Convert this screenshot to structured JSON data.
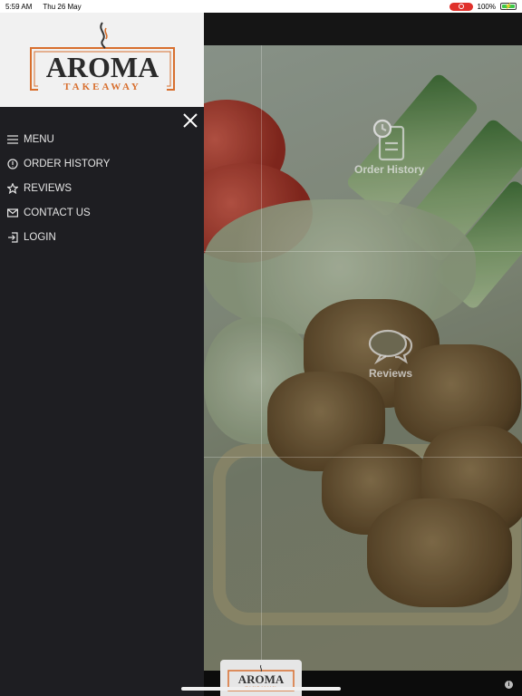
{
  "status_bar": {
    "time": "5:59 AM",
    "date": "Thu 26 May",
    "battery": "100%"
  },
  "brand": {
    "name_main": "AROMA",
    "name_sub": "TAKEAWAY",
    "accent_color": "#d86f2e"
  },
  "menu": {
    "items": [
      {
        "label": "MENU",
        "icon": "hamburger-icon"
      },
      {
        "label": "ORDER HISTORY",
        "icon": "info-circle-icon"
      },
      {
        "label": "REVIEWS",
        "icon": "star-icon"
      },
      {
        "label": "CONTACT US",
        "icon": "envelope-icon"
      },
      {
        "label": "LOGIN",
        "icon": "login-icon"
      }
    ]
  },
  "tiles": [
    {
      "label": "Order History",
      "icon": "clipboard-clock-icon"
    },
    {
      "label": "Reviews",
      "icon": "chat-bubbles-icon"
    }
  ]
}
